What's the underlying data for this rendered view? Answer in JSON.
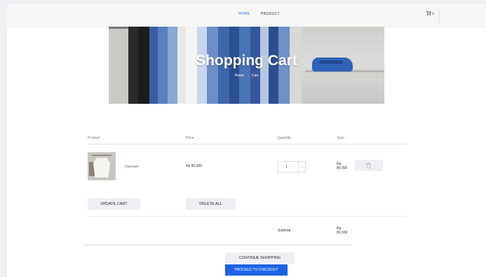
{
  "nav": {
    "links": [
      "HOME",
      "PRODUCT"
    ],
    "active": "HOME",
    "cart_count": "1"
  },
  "hero": {
    "title": "Shopping Cart",
    "breadcrumb": [
      "Home",
      "Cart"
    ],
    "separator": "→"
  },
  "cart": {
    "columns": [
      "Product",
      "Price",
      "Quantity",
      "Total"
    ],
    "items": [
      {
        "name": "Oversize",
        "price": "Rp 80,000",
        "quantity": "1",
        "total_currency": "Rp",
        "total_amount": "80,000"
      }
    ],
    "update_label": "UPDATE CART",
    "delete_all_label": "DELETE ALL",
    "subtotal_label": "Subtotal",
    "subtotal_currency": "Rp",
    "subtotal_amount": "80,000",
    "continue_label": "CONTINUE SHOPPING",
    "checkout_label": "PROCEED TO CHECKOUT"
  },
  "colors": {
    "accent": "#1e63e6",
    "active_nav": "#2f6fe0",
    "button_light": "#eeeff3",
    "hero_jacket": "#2f63b8"
  },
  "icons": [
    "cart-icon",
    "trash-icon"
  ]
}
